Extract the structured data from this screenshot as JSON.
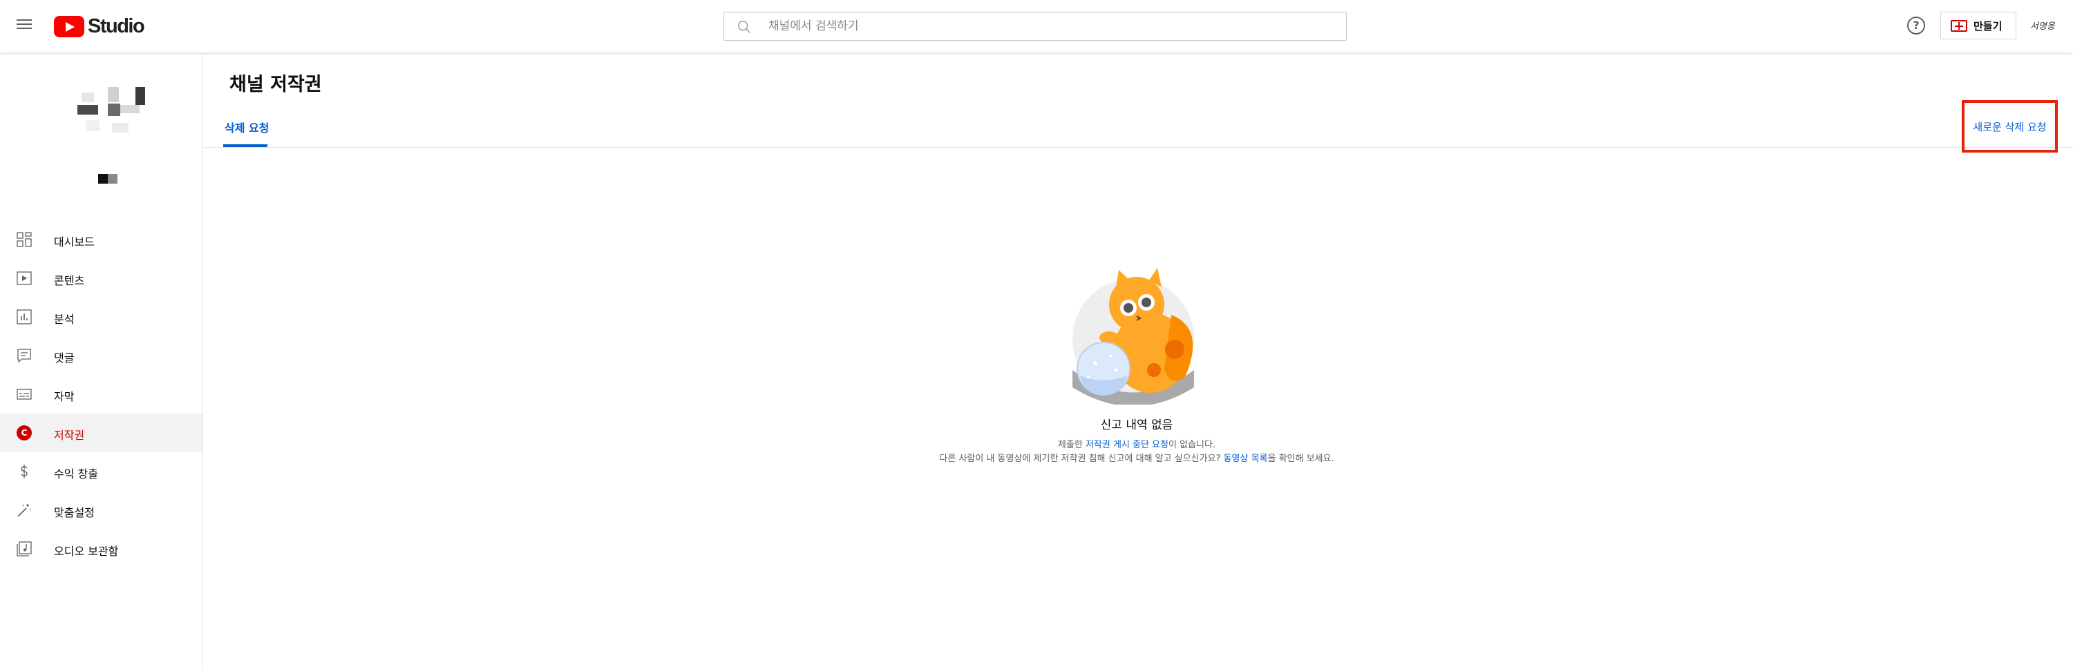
{
  "header": {
    "logo_text": "Studio",
    "search_placeholder": "채널에서 검색하기",
    "help_symbol": "?",
    "create_label": "만들기",
    "account_label": "서영웅"
  },
  "sidebar": {
    "items": [
      {
        "label": "대시보드",
        "icon": "dashboard-icon"
      },
      {
        "label": "콘텐츠",
        "icon": "content-icon"
      },
      {
        "label": "분석",
        "icon": "analytics-icon"
      },
      {
        "label": "댓글",
        "icon": "comments-icon"
      },
      {
        "label": "자막",
        "icon": "subtitles-icon"
      },
      {
        "label": "저작권",
        "icon": "copyright-icon",
        "active": true,
        "icon_letter": "C"
      },
      {
        "label": "수익 창출",
        "icon": "dollar-icon"
      },
      {
        "label": "맞춤설정",
        "icon": "magic-wand-icon"
      },
      {
        "label": "오디오 보관함",
        "icon": "audio-library-icon"
      }
    ]
  },
  "main": {
    "title": "채널 저작권",
    "tab_label": "삭제 요청",
    "new_request_label": "새로운 삭제 요청",
    "empty_state": {
      "title": "신고 내역 없음",
      "line1_prefix": "제출한 ",
      "line1_link": "저작권 게시 중단 요청",
      "line1_suffix": "이 없습니다.",
      "line2_prefix": "다른 사람이 내 동영상에 제기한 저작권 침해 신고에 대해 알고 싶으신가요? ",
      "line2_link": "동영상 목록",
      "line2_suffix": "을 확인해 보세요."
    }
  },
  "colors": {
    "accent_red": "#cc0000",
    "link_blue": "#065fd4",
    "highlight_box": "#e8210b"
  }
}
